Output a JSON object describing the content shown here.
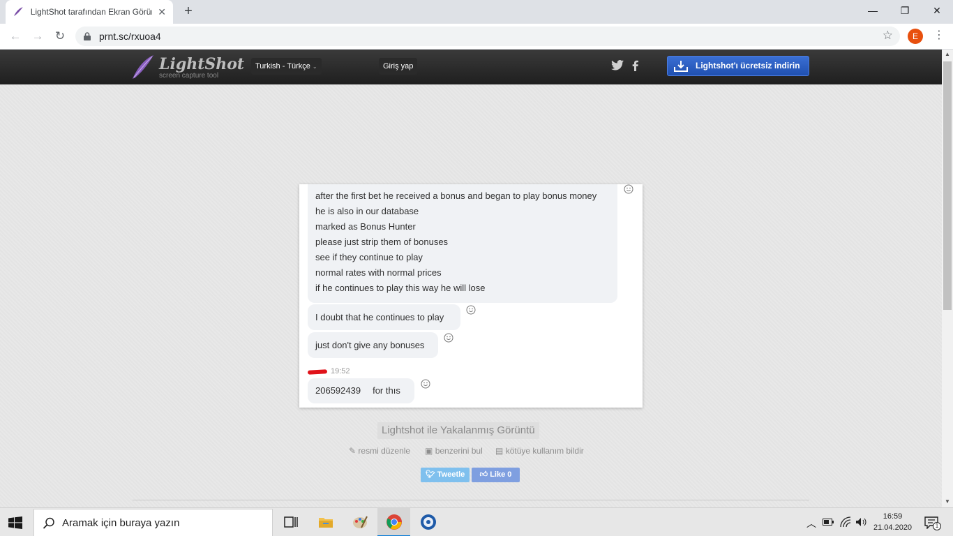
{
  "browser": {
    "tab_title": "LightShot tarafından Ekran Görüntüsü",
    "url": "prnt.sc/rxuoa4",
    "profile_initial": "E"
  },
  "site": {
    "logo_name": "LightShot",
    "logo_subtitle": "screen capture tool",
    "language": "Turkish - Türkçe",
    "login": "Giriş yap",
    "download": "Lightshot'ı ücretsiz indirin"
  },
  "chat": {
    "block_lines": [
      "after the first bet he received a bonus and began to play bonus money",
      "he is also in our database",
      "marked as Bonus Hunter",
      "please just strip them of bonuses",
      "see if they continue to play",
      "normal rates with normal prices",
      "if he continues to play this way he will lose"
    ],
    "message_2": "I doubt that he continues to play",
    "message_3": "just don't give any bonuses",
    "time": "19:52",
    "message_4_number": "206592439",
    "message_4_text": "for thıs"
  },
  "caption": "Lightshot ile Yakalanmış Görüntü",
  "actions": {
    "edit": "resmi düzenle",
    "similar": "benzerini bul",
    "report": "kötüye kullanım bildir"
  },
  "share": {
    "tweet": "Tweetle",
    "like": "Like 0"
  },
  "taskbar": {
    "search_placeholder": "Aramak için buraya yazın",
    "time": "16:59",
    "date": "21.04.2020",
    "notification_count": "1"
  },
  "colors": {
    "download_button": "#2a5cc4",
    "header_bg": "#262626",
    "profile": "#e8500e",
    "redaction": "#e0121a"
  }
}
